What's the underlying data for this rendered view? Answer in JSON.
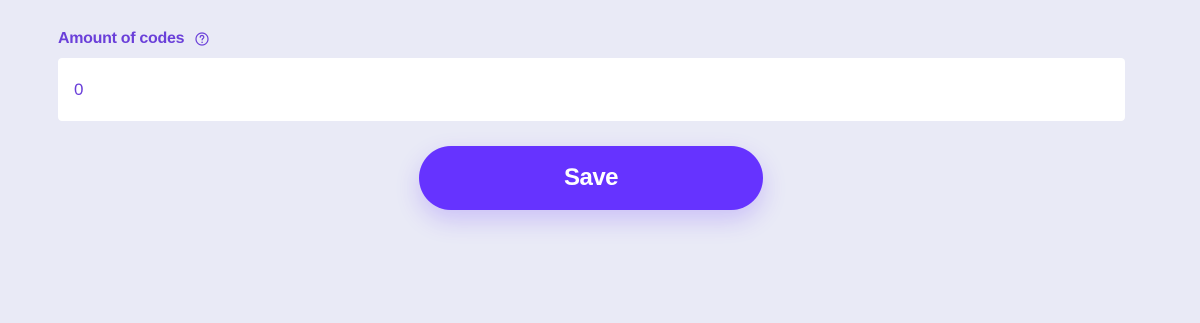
{
  "form": {
    "label": "Amount of codes",
    "help_icon": "question-circle-icon",
    "input_value": "0"
  },
  "actions": {
    "save_label": "Save"
  },
  "colors": {
    "background": "#e9eaf6",
    "label": "#6a3fd9",
    "accent": "#6633ff",
    "input_background": "#ffffff"
  }
}
